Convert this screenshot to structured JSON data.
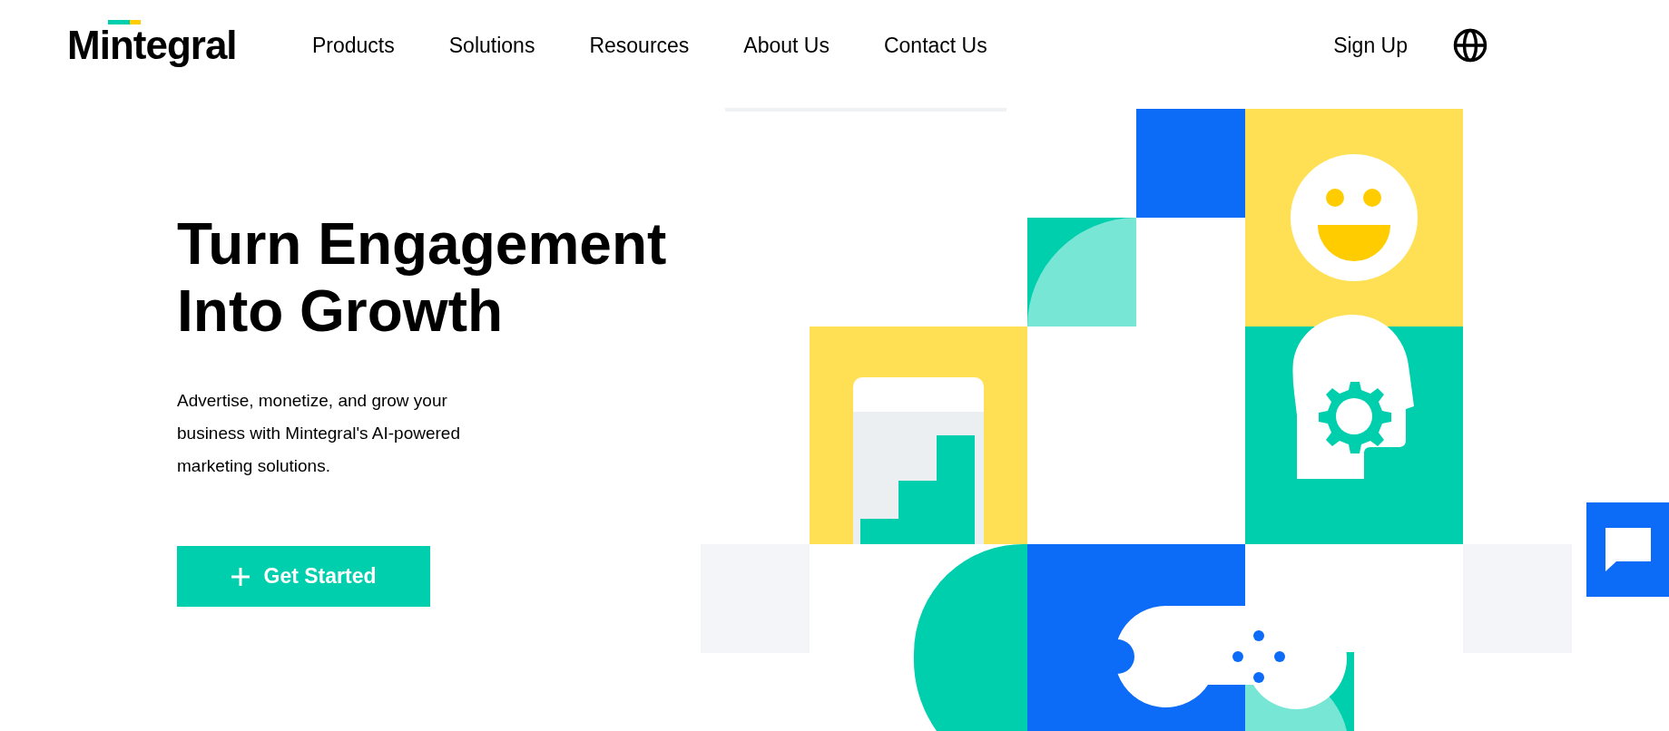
{
  "header": {
    "logo": "Mintegral",
    "nav": [
      {
        "label": "Products"
      },
      {
        "label": "Solutions"
      },
      {
        "label": "Resources"
      },
      {
        "label": "About Us"
      },
      {
        "label": "Contact Us"
      }
    ],
    "sign_up": "Sign Up"
  },
  "hero": {
    "title": "Turn Engagement Into Growth",
    "subtitle": "Advertise, monetize, and grow your business with Mintegral's AI-powered marketing solutions.",
    "cta": "Get Started"
  }
}
